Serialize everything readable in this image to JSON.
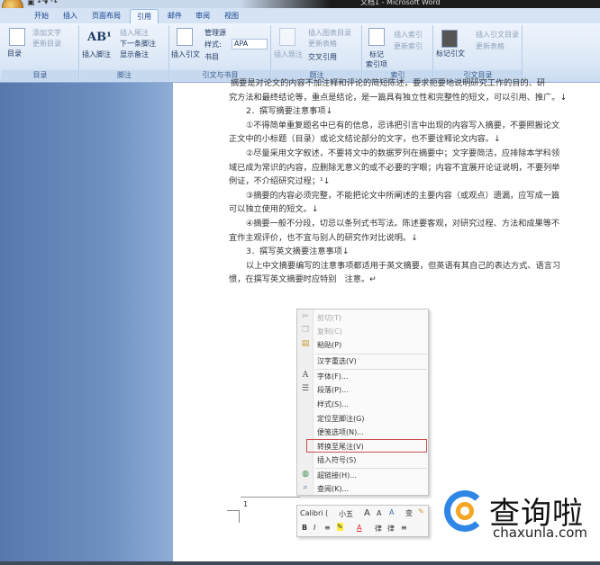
{
  "window": {
    "title": "文档1 - Microsoft Word"
  },
  "quick_access": [
    "save",
    "undo",
    "redo"
  ],
  "tabs": [
    "开始",
    "插入",
    "页面布局",
    "引用",
    "邮件",
    "审阅",
    "视图"
  ],
  "active_tab": "引用",
  "ribbon": {
    "toc": {
      "big": "目录",
      "items": [
        "添加文字",
        "更新目录"
      ],
      "label": "目录"
    },
    "footnotes": {
      "big": "插入脚注",
      "items": [
        "插入尾注",
        "下一条脚注",
        "显示备注"
      ],
      "label": "脚注"
    },
    "citations": {
      "big": "插入引文",
      "items": [
        "管理源",
        "样式:",
        "书目"
      ],
      "style_value": "APA",
      "label": "引文与书目"
    },
    "captions": {
      "big": "插入题注",
      "items": [
        "插入图表目录",
        "更新表格",
        "交叉引用"
      ],
      "label": "题注"
    },
    "index": {
      "big1": "标记",
      "big2": "索引项",
      "items": [
        "插入索引",
        "更新索引"
      ],
      "label": "索引"
    },
    "toa": {
      "big": "标记引文",
      "items": [
        "插入引文目录",
        "更新表格"
      ],
      "label": "引文目录"
    }
  },
  "document": {
    "paragraphs": [
      "摘要是对论文的内容不加注释和评论的简短陈述，要求扼要地说明研究工作的目的、研",
      "究方法和最终结论等，重点是结论，是一篇具有独立性和完整性的短文，可以引用、推广。↓",
      "2．撰写摘要注意事项↓",
      "①不得简单重复题名中已有的信息，忌讳把引言中出现的内容写入摘要，不要照搬论文",
      "正文中的小标题（目录）或论文结论部分的文字，也不要诠释论文内容。↓",
      "②尽量采用文字叙述，不要将文中的数据罗列在摘要中；文字要简洁，应排除本学科领",
      "域已成为常识的内容，应删除无意义的或不必要的字眼；内容不宜展开论证说明，不要列举",
      "例证，不介绍研究过程；¹↓",
      "③摘要的内容必须完整，不能把论文中所阐述的主要内容（或观点）遗漏，应写成一篇",
      "可以独立使用的短文。↓",
      "④摘要一般不分段，切忌以条列式书写法。陈述要客观，对研究过程、方法和成果等不",
      "宜作主观评价，也不宜与别人的研究作对比说明。↓",
      "3．撰写英文摘要注意事项↓",
      "以上中文摘要编写的注意事项都适用于英文摘要，但英语有其自己的表达方式、语言习",
      "惯，在撰写英文摘要时应特别　注意。↵"
    ],
    "footnote_mark": "1"
  },
  "context_menu": {
    "items": [
      {
        "label": "剪切(T)",
        "icon": "scissors-icon",
        "disabled": true
      },
      {
        "label": "复制(C)",
        "icon": "copy-icon",
        "disabled": true
      },
      {
        "label": "粘贴(P)",
        "icon": "paste-icon",
        "disabled": false
      },
      {
        "label": "汉字重选(V)",
        "disabled": false
      },
      {
        "label": "字体(F)...",
        "icon": "font-icon",
        "disabled": false
      },
      {
        "label": "段落(P)...",
        "icon": "paragraph-icon",
        "disabled": false
      },
      {
        "label": "样式(S)...",
        "disabled": false
      },
      {
        "label": "定位至脚注(G)",
        "disabled": false
      },
      {
        "label": "便笺选项(N)...",
        "disabled": false
      },
      {
        "label": "转换至尾注(V)",
        "disabled": false,
        "highlighted": true
      },
      {
        "label": "插入符号(S)",
        "disabled": false
      },
      {
        "label": "超链接(H)...",
        "icon": "hyperlink-icon",
        "disabled": false
      },
      {
        "label": "查阅(K)...",
        "icon": "lookup-icon",
        "disabled": false
      }
    ],
    "highlight_color": "#c8504f"
  },
  "mini_toolbar": {
    "font": "Calibri (",
    "size": "小五",
    "row1": [
      "A",
      "A",
      "A",
      "变"
    ],
    "row2": [
      "B",
      "I",
      "≡",
      "A",
      "律",
      "律",
      "≡"
    ]
  },
  "watermark": {
    "cn": "查询啦",
    "en": "chaxunla.com"
  }
}
